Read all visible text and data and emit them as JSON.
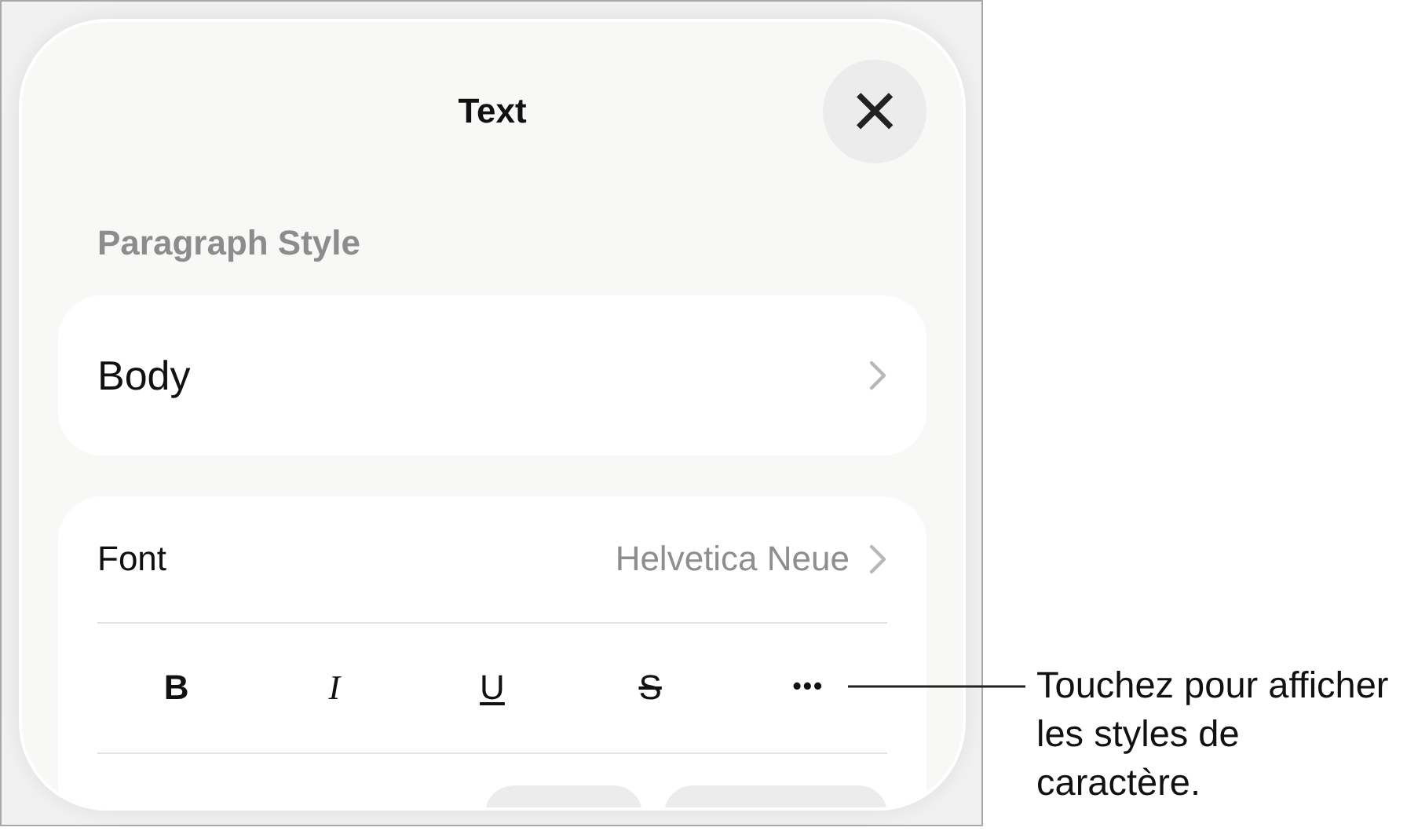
{
  "panel": {
    "title": "Text",
    "close": "×"
  },
  "paragraph_style": {
    "label": "Paragraph Style",
    "value": "Body"
  },
  "font": {
    "label": "Font",
    "value": "Helvetica Neue"
  },
  "style_buttons": [
    {
      "kind": "bold",
      "label": "B"
    },
    {
      "kind": "italic",
      "label": "I"
    },
    {
      "kind": "underline",
      "label": "U"
    },
    {
      "kind": "strikethrough",
      "label": "S"
    },
    {
      "kind": "more",
      "label": "•••"
    }
  ],
  "callout": "Touchez pour afficher les styles de caractère."
}
